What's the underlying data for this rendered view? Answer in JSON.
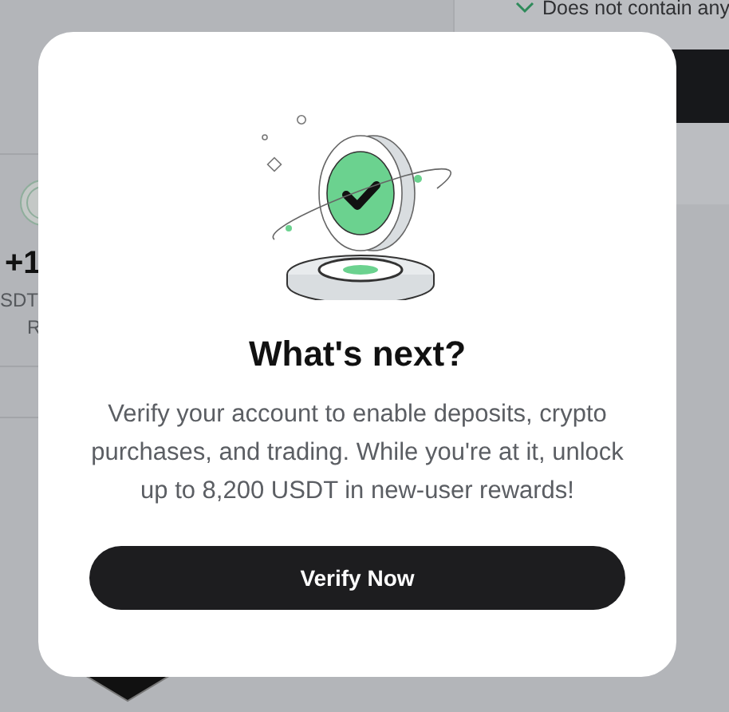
{
  "background": {
    "requirement": "Does not contain any",
    "reward_amount": "+1",
    "reward_unit": "SDT",
    "reward_label": "R"
  },
  "modal": {
    "title": "What's next?",
    "message": "Verify your account to enable deposits, crypto purchases, and trading. While you're at it, unlock up to 8,200 USDT in new-user rewards!",
    "button": "Verify Now"
  }
}
